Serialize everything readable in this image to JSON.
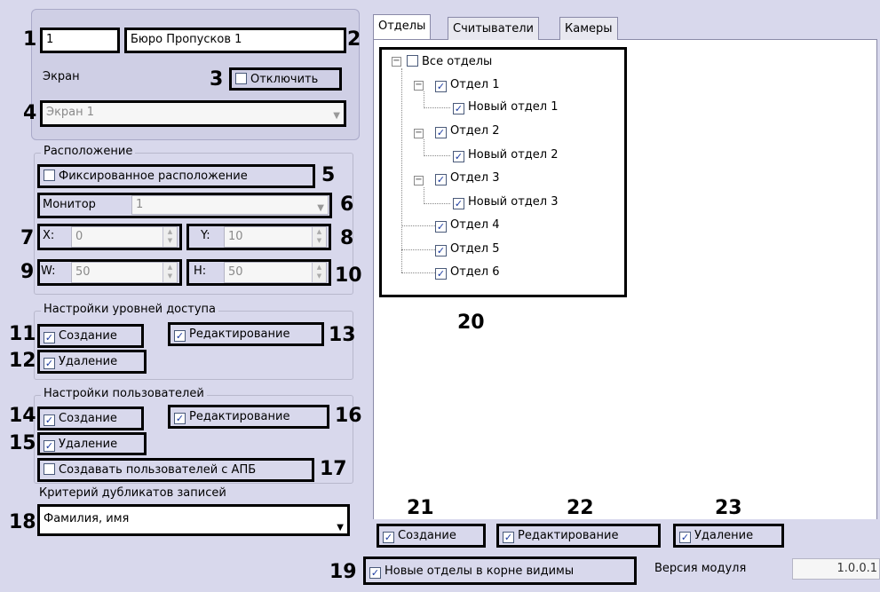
{
  "top": {
    "id_value": "1",
    "name_value": "Бюро Пропусков 1",
    "screen_label": "Экран",
    "disable_label": "Отключить",
    "disable_checked": false,
    "screen_select": "Экран 1"
  },
  "location": {
    "title": "Расположение",
    "fixed_label": "Фиксированное расположение",
    "fixed_checked": false,
    "monitor_label": "Монитор",
    "monitor_value": "1",
    "x_label": "X:",
    "x_value": "0",
    "y_label": "Y:",
    "y_value": "10",
    "w_label": "W:",
    "w_value": "50",
    "h_label": "H:",
    "h_value": "50"
  },
  "access_levels": {
    "title": "Настройки уровней доступа",
    "create_label": "Создание",
    "edit_label": "Редактирование",
    "delete_label": "Удаление"
  },
  "users": {
    "title": "Настройки пользователей",
    "create_label": "Создание",
    "edit_label": "Редактирование",
    "delete_label": "Удаление",
    "apb_label": "Создавать пользователей с АПБ",
    "duplicates_label": "Критерий дубликатов записей",
    "duplicates_value": "Фамилия, имя"
  },
  "tabs": [
    "Отделы",
    "Считыватели",
    "Камеры"
  ],
  "tree": [
    {
      "label": "Все отделы",
      "checked": false,
      "level": 0
    },
    {
      "label": "Отдел 1",
      "checked": true,
      "level": 1
    },
    {
      "label": "Новый отдел 1",
      "checked": true,
      "level": 2
    },
    {
      "label": "Отдел 2",
      "checked": true,
      "level": 1
    },
    {
      "label": "Новый отдел 2",
      "checked": true,
      "level": 2
    },
    {
      "label": "Отдел 3",
      "checked": true,
      "level": 1
    },
    {
      "label": "Новый отдел 3",
      "checked": true,
      "level": 2
    },
    {
      "label": "Отдел 4",
      "checked": true,
      "level": 1
    },
    {
      "label": "Отдел 5",
      "checked": true,
      "level": 1
    },
    {
      "label": "Отдел 6",
      "checked": true,
      "level": 1
    }
  ],
  "dept_actions": {
    "create_label": "Создание",
    "edit_label": "Редактирование",
    "delete_label": "Удаление"
  },
  "footer": {
    "new_depts_label": "Новые отделы в корне видимы",
    "version_label": "Версия модуля",
    "version_value": "1.0.0.1"
  },
  "callouts": [
    "1",
    "2",
    "3",
    "4",
    "5",
    "6",
    "7",
    "8",
    "9",
    "10",
    "11",
    "12",
    "13",
    "14",
    "15",
    "16",
    "17",
    "18",
    "19",
    "20",
    "21",
    "22",
    "23"
  ],
  "icons": {
    "checkbox_checked": "check-mark",
    "tree_expand": "minus-box",
    "dropdown": "chevron-down-icon",
    "spin": "spin-arrows-icon"
  },
  "colors": {
    "panel": "#d8d8ec",
    "check": "#1a3aa0",
    "callout_border": "#000000"
  }
}
